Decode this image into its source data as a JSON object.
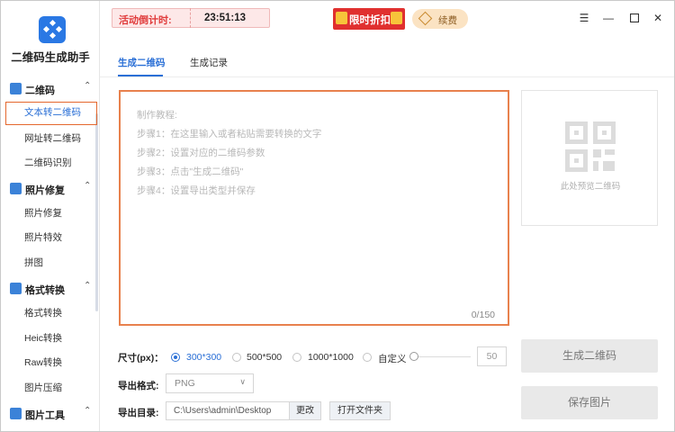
{
  "app": {
    "name": "二维码生成助手"
  },
  "colors": {
    "accent": "#2a6fd6",
    "highlight": "#e8814d",
    "promo": "#e0302f"
  },
  "sidebar": {
    "groups": [
      {
        "label": "二维码",
        "icon": "qrcode-icon",
        "items": [
          "文本转二维码",
          "网址转二维码",
          "二维码识别"
        ]
      },
      {
        "label": "照片修复",
        "icon": "photo-icon",
        "items": [
          "照片修复",
          "照片特效",
          "拼图"
        ]
      },
      {
        "label": "格式转换",
        "icon": "convert-icon",
        "items": [
          "格式转换",
          "Heic转换",
          "Raw转换",
          "图片压缩"
        ]
      },
      {
        "label": "图片工具",
        "icon": "image-tools-icon",
        "items": []
      }
    ],
    "active_item": "文本转二维码"
  },
  "topbar": {
    "countdown_label": "活动倒计时:",
    "countdown_time": "23:51:13",
    "promo_label": "限时折扣",
    "renew_label": "续费",
    "window_controls": [
      "menu-icon",
      "minimize-icon",
      "maximize-icon",
      "close-icon"
    ]
  },
  "tabs": [
    {
      "label": "生成二维码",
      "active": true
    },
    {
      "label": "生成记录",
      "active": false
    }
  ],
  "editor": {
    "placeholder_lines": [
      "制作教程:",
      "步骤1：在这里输入或者粘贴需要转换的文字",
      "步骤2：设置对应的二维码参数",
      "步骤3：点击\"生成二维码\"",
      "步骤4：设置导出类型并保存"
    ],
    "char_count": "0/150"
  },
  "preview": {
    "placeholder": "此处预览二维码"
  },
  "size": {
    "label": "尺寸(px)：",
    "options": [
      "300*300",
      "500*500",
      "1000*1000",
      "自定义"
    ],
    "selected": "300*300",
    "custom_value": "50"
  },
  "format": {
    "label": "导出格式:",
    "value": "PNG"
  },
  "directory": {
    "label": "导出目录:",
    "path": "C:\\Users\\admin\\Desktop",
    "change_label": "更改",
    "open_label": "打开文件夹"
  },
  "actions": {
    "generate_label": "生成二维码",
    "save_label": "保存图片"
  }
}
